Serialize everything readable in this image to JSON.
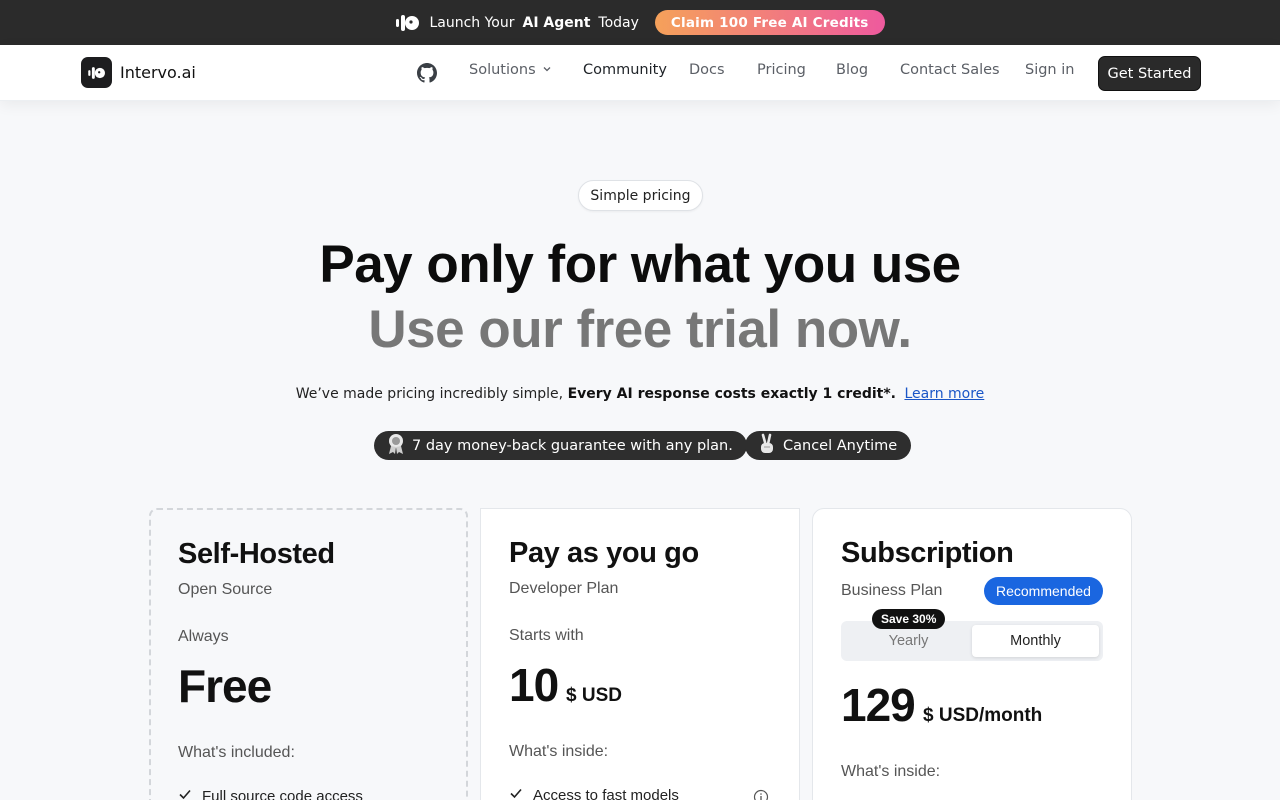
{
  "banner": {
    "prefix": "Launch Your",
    "highlight": "AI Agent",
    "suffix": "Today",
    "cta": "Claim 100 Free AI Credits"
  },
  "nav": {
    "brand": "Intervo.ai",
    "items": [
      "Solutions",
      "Community",
      "Docs",
      "Pricing",
      "Blog",
      "Contact Sales",
      "Sign in"
    ],
    "cta": "Get Started"
  },
  "hero": {
    "pill": "Simple pricing",
    "title_line1": "Pay only for what you use",
    "title_line2": "Use our free trial now.",
    "sub_prefix": "We’ve made pricing incredibly simple,",
    "sub_bold": "Every AI response costs exactly 1 credit*.",
    "sub_link": "Learn more",
    "chip_guarantee": "7 day money-back guarantee with any plan.",
    "chip_cancel": "Cancel Anytime"
  },
  "plans": {
    "self_hosted": {
      "title": "Self-Hosted",
      "subtitle": "Open Source",
      "price_label": "Always",
      "price": "Free",
      "included_label": "What's included:",
      "features": [
        "Full source code access"
      ]
    },
    "payg": {
      "title": "Pay as you go",
      "subtitle": "Developer Plan",
      "price_label": "Starts with",
      "price": "10",
      "price_unit": "$ USD",
      "included_label": "What's inside:",
      "features": [
        "Access to fast models"
      ]
    },
    "subscription": {
      "title": "Subscription",
      "subtitle": "Business Plan",
      "badge": "Recommended",
      "save_badge": "Save 30%",
      "toggle_yearly": "Yearly",
      "toggle_monthly": "Monthly",
      "price": "129",
      "price_unit": "$ USD/month",
      "included_label": "What's inside:"
    }
  },
  "colors": {
    "accent_blue": "#1a66e0",
    "banner_bg": "#2b2b2b",
    "claim_gradient_start": "#f5a15a",
    "claim_gradient_end": "#ee5a9e"
  }
}
